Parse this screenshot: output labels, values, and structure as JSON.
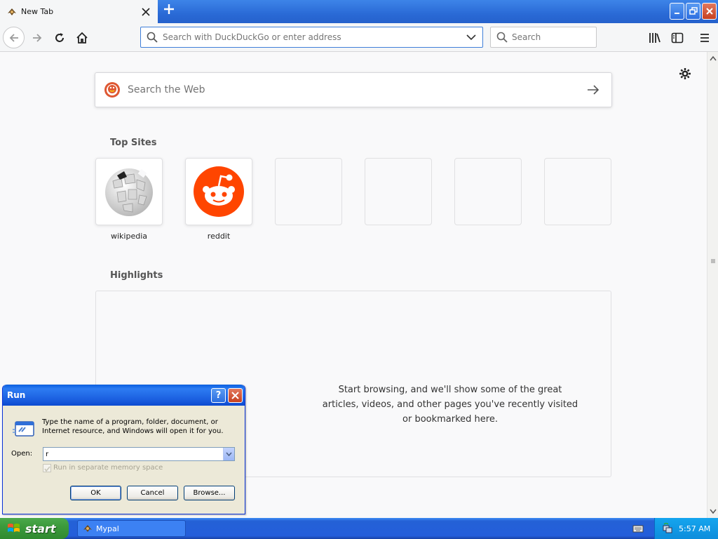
{
  "browser": {
    "tab_title": "New Tab",
    "urlbar_placeholder": "Search with DuckDuckGo or enter address",
    "searchbar_placeholder": "Search"
  },
  "newtab": {
    "web_search_placeholder": "Search the Web",
    "top_sites_title": "Top Sites",
    "top_sites": [
      {
        "label": "wikipedia"
      },
      {
        "label": "reddit"
      },
      {
        "label": ""
      },
      {
        "label": ""
      },
      {
        "label": ""
      },
      {
        "label": ""
      }
    ],
    "highlights_title": "Highlights",
    "highlights_message": "Start browsing, and we'll show some of the great articles, videos, and other pages you've recently visited or bookmarked here."
  },
  "run_dialog": {
    "title": "Run",
    "description": "Type the name of a program, folder, document, or Internet resource, and Windows will open it for you.",
    "open_label": "Open:",
    "open_value": "r",
    "separate_memory_label": "Run in separate memory space",
    "ok_label": "OK",
    "cancel_label": "Cancel",
    "browse_label": "Browse..."
  },
  "taskbar": {
    "start_label": "start",
    "task_label": "Mypal",
    "clock": "5:57 AM"
  },
  "colors": {
    "xp_blue": "#245edb",
    "start_green": "#3c9a3c",
    "reddit_orange": "#ff4500",
    "urlbar_focus": "#3f7fd9"
  }
}
